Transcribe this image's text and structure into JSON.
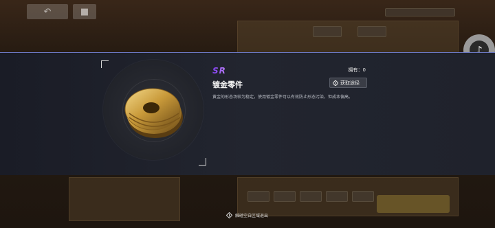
{
  "item": {
    "rarity": "SR",
    "name": "镀金零件",
    "owned": "拥有：0",
    "source_button": "获取途径",
    "description": "黄金的形态场较为稳定，使用镀金零件可以有效防止形态污染，但成本偏高。"
  },
  "footer": {
    "exit_hint": "触碰空白区域退出"
  },
  "icons": {
    "back": "back-arrow-icon",
    "source": "diamond-nav-icon",
    "exit": "diamond-nav-icon",
    "tiktok": "tiktok-icon"
  },
  "colors": {
    "panel_border": "#6b78c4",
    "rarity_gradient_start": "#7c3aed",
    "rarity_gradient_end": "#c084fc",
    "gold": "#c99a3a"
  }
}
